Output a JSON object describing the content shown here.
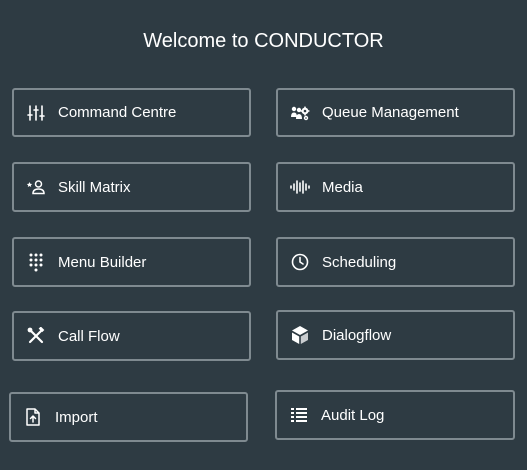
{
  "header": {
    "title": "Welcome to CONDUCTOR"
  },
  "tiles": [
    {
      "label": "Command Centre",
      "icon": "sliders-icon"
    },
    {
      "label": "Queue Management",
      "icon": "group-settings-icon"
    },
    {
      "label": "Skill Matrix",
      "icon": "person-star-icon"
    },
    {
      "label": "Media",
      "icon": "waveform-icon"
    },
    {
      "label": "Menu Builder",
      "icon": "dialpad-icon"
    },
    {
      "label": "Scheduling",
      "icon": "clock-icon"
    },
    {
      "label": "Call Flow",
      "icon": "tools-icon"
    },
    {
      "label": "Dialogflow",
      "icon": "dialogflow-icon"
    },
    {
      "label": "Import",
      "icon": "file-upload-icon"
    },
    {
      "label": "Audit Log",
      "icon": "list-icon"
    }
  ],
  "colors": {
    "background": "#2e3b43",
    "border": "#7f8a90",
    "text": "#ffffff"
  }
}
